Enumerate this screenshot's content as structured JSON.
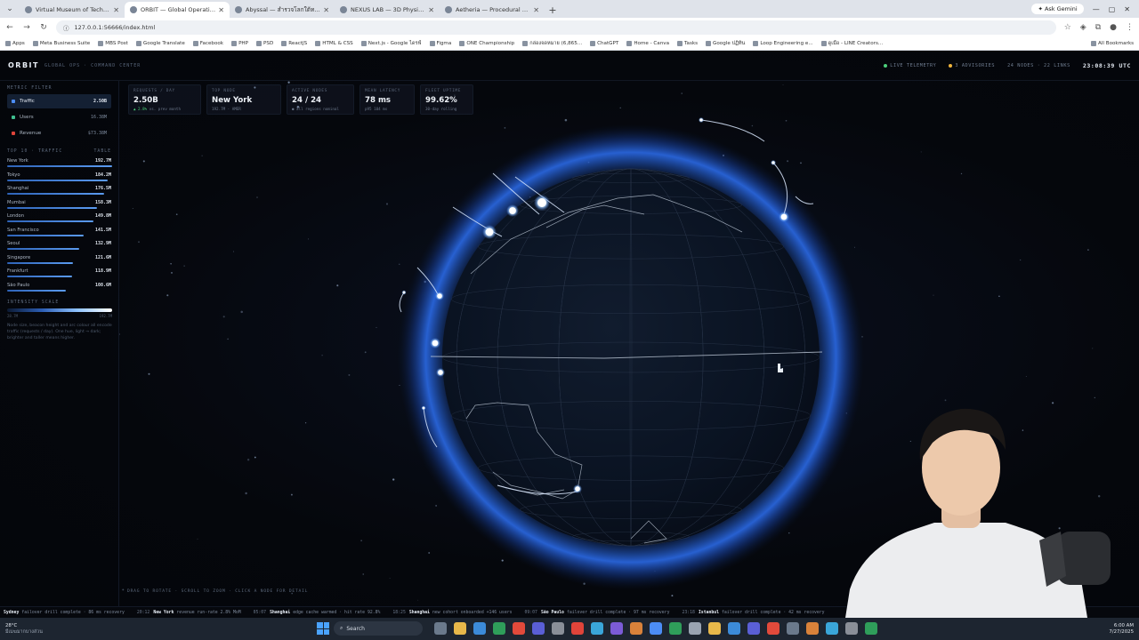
{
  "browser": {
    "tabs": [
      {
        "label": "Virtual Museum of Technology",
        "active": false
      },
      {
        "label": "ORBIT — Global Operations Ce",
        "active": true
      },
      {
        "label": "Abyssal — สำรวจโลกใต้ทะเล 3D",
        "active": false
      },
      {
        "label": "NEXUS LAB — 3D Physics Play",
        "active": false
      },
      {
        "label": "Aetheria — Procedural Fantasy",
        "active": false
      }
    ],
    "ask_gemini": "Ask Gemini",
    "url": "127.0.0.1:56666/index.html",
    "bookmarks": [
      "Apps",
      "Meta Business Suite",
      "MBS Post",
      "Google Translate",
      "Facebook",
      "PHP",
      "PSD",
      "ReactJS",
      "HTML & CSS",
      "Next.js - Google ไดรฟ์",
      "Figma",
      "ONE Championship",
      "กล่องจดหมาย (6,865...",
      "ChatGPT",
      "Home - Canva",
      "Tasks",
      "Google ปฏิทิน",
      "Loop Engineering e...",
      "ดูเมือ - LINE Creators..."
    ],
    "all_bookmarks": "All Bookmarks"
  },
  "app": {
    "brand": "ORBIT",
    "brand_sub": "GLOBAL OPS · COMMAND CENTER",
    "status": {
      "live": "LIVE TELEMETRY",
      "advisories": "3 ADVISORIES",
      "nodes_links": "24 NODES · 22 LINKS",
      "clock": "23:08:39 UTC"
    },
    "sidebar": {
      "metric_title": "METRIC FILTER",
      "metrics": [
        {
          "label": "Traffic",
          "value": "2.50B",
          "color": "#4c8df6",
          "active": true
        },
        {
          "label": "Users",
          "value": "16.38M",
          "color": "#3fbf8f",
          "active": false
        },
        {
          "label": "Revenue",
          "value": "$73.38M",
          "color": "#e0443a",
          "active": false
        }
      ],
      "top10_title": "TOP 10 · TRAFFIC",
      "top10_link": "TABLE",
      "cities": [
        {
          "name": "New York",
          "value": "192.7M",
          "pct": 100
        },
        {
          "name": "Tokyo",
          "value": "184.2M",
          "pct": 96
        },
        {
          "name": "Shanghai",
          "value": "176.5M",
          "pct": 92
        },
        {
          "name": "Mumbai",
          "value": "158.3M",
          "pct": 86
        },
        {
          "name": "London",
          "value": "149.8M",
          "pct": 82
        },
        {
          "name": "San Francisco",
          "value": "141.5M",
          "pct": 73
        },
        {
          "name": "Seoul",
          "value": "132.9M",
          "pct": 69
        },
        {
          "name": "Singapore",
          "value": "121.6M",
          "pct": 63
        },
        {
          "name": "Frankfurt",
          "value": "118.9M",
          "pct": 62
        },
        {
          "name": "São Paulo",
          "value": "108.6M",
          "pct": 56
        }
      ],
      "intensity_title": "INTENSITY SCALE",
      "scale_min": "28.7M",
      "scale_max": "192.7M",
      "description": "Node size, beacon height and arc colour all encode traffic (requests / day). One hue, light → dark; brighter and taller means higher."
    },
    "kpis": [
      {
        "label": "REQUESTS / DAY",
        "value": "2.50B",
        "delta": "▲ 2.8%",
        "sub": "vs. prev month"
      },
      {
        "label": "TOP NODE",
        "value": "New York",
        "delta": "",
        "sub": "192.7M · AMER"
      },
      {
        "label": "ACTIVE NODES",
        "value": "24 / 24",
        "delta": "",
        "sub": "● all regions nominal"
      },
      {
        "label": "MEAN LATENCY",
        "value": "78 ms",
        "delta": "",
        "sub": "p95 104 ms"
      },
      {
        "label": "FLEET UPTIME",
        "value": "99.62%",
        "delta": "",
        "sub": "30-day rolling"
      }
    ],
    "hint": "DRAG TO ROTATE · SCROLL TO ZOOM · CLICK A NODE FOR DETAIL",
    "ticker": [
      {
        "time": "",
        "city": "Sydney",
        "msg": "failover drill complete · 86 ms recovery"
      },
      {
        "time": "20:12",
        "city": "New York",
        "msg": "revenue run-rate 2.8% MoM"
      },
      {
        "time": "05:07",
        "city": "Shanghai",
        "msg": "edge cache warmed · hit rate 92.8%"
      },
      {
        "time": "18:25",
        "city": "Shanghai",
        "msg": "new cohort onboarded +146 users"
      },
      {
        "time": "09:07",
        "city": "São Paulo",
        "msg": "failover drill complete · 97 ms recovery"
      },
      {
        "time": "23:18",
        "city": "Istanbul",
        "msg": "failover drill complete · 42 ms recovery"
      }
    ]
  },
  "taskbar": {
    "temp": "28°C",
    "weather": "มีเมฆมากบางส่วน",
    "search": "Search",
    "time": "6:00 AM",
    "date": "7/27/2025"
  },
  "colors": {
    "accent": "#4c8df6",
    "glow": "#2f6fe0",
    "positive": "#4ccf7a"
  }
}
